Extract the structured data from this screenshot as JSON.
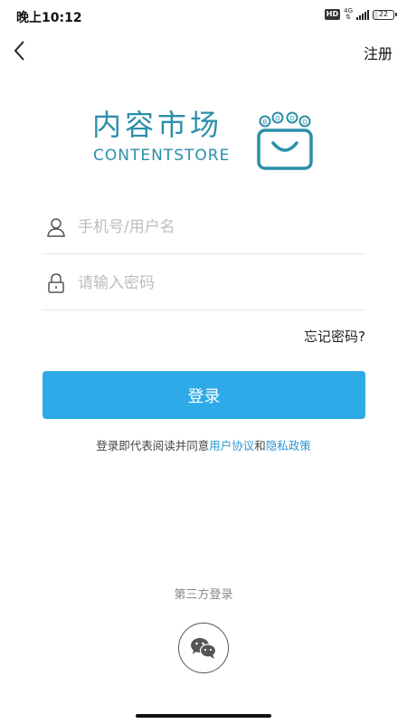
{
  "status_bar": {
    "time": "晚上10:12",
    "hd": "HD",
    "network": "4G",
    "battery": "22"
  },
  "nav": {
    "back_icon": "chevron-left-icon",
    "register_label": "注册"
  },
  "logo": {
    "title_cn": "内容市场",
    "title_en": "CONTENTSTORE",
    "bag_letters": [
      "B",
      "O",
      "D",
      "O"
    ]
  },
  "form": {
    "username_placeholder": "手机号/用户名",
    "username_value": "",
    "username_icon": "user-icon",
    "password_placeholder": "请输入密码",
    "password_value": "",
    "password_icon": "lock-icon",
    "forgot_label": "忘记密码?",
    "login_label": "登录"
  },
  "agreement": {
    "prefix": "登录即代表阅读并同意",
    "user_agreement": "用户协议",
    "conjunction": "和",
    "privacy_policy": "隐私政策"
  },
  "third_party": {
    "label": "第三方登录",
    "wechat_icon": "wechat-icon"
  },
  "colors": {
    "accent": "#2eaae8",
    "brand": "#2b8fa9",
    "link": "#2b98d6"
  }
}
